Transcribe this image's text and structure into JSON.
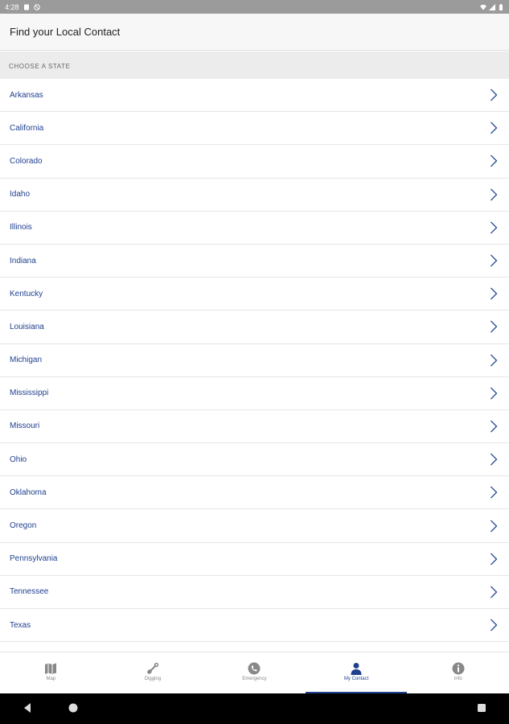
{
  "status_bar": {
    "time": "4:28"
  },
  "app_bar": {
    "title": "Find your Local Contact"
  },
  "section": {
    "header": "Choose a state"
  },
  "states": [
    "Arkansas",
    "California",
    "Colorado",
    "Idaho",
    "Illinois",
    "Indiana",
    "Kentucky",
    "Louisiana",
    "Michigan",
    "Mississippi",
    "Missouri",
    "Ohio",
    "Oklahoma",
    "Oregon",
    "Pennsylvania",
    "Tennessee",
    "Texas"
  ],
  "bottom_nav": {
    "tabs": [
      {
        "label": "Map",
        "icon": "map-icon",
        "active": false
      },
      {
        "label": "Digging",
        "icon": "shovel-icon",
        "active": false
      },
      {
        "label": "Emergency",
        "icon": "phone-icon",
        "active": false
      },
      {
        "label": "My Contact",
        "icon": "person-icon",
        "active": true
      },
      {
        "label": "Info",
        "icon": "info-icon",
        "active": false
      }
    ]
  },
  "colors": {
    "accent": "#1f3f8f",
    "status_bar": "#9b9b9b"
  }
}
